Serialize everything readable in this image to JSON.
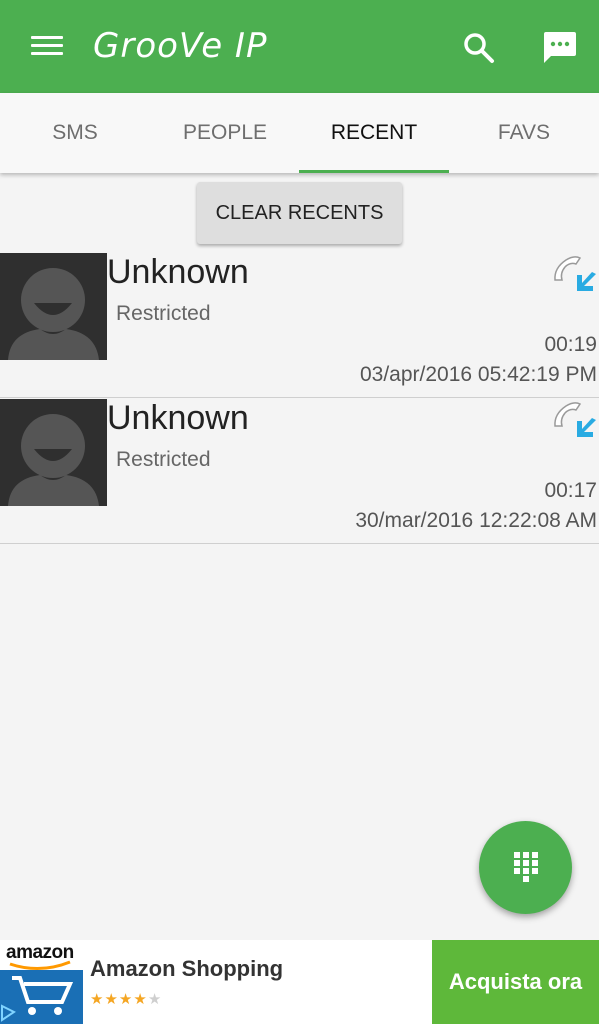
{
  "app": {
    "title": "GrooVe IP",
    "accent_color": "#4caf50"
  },
  "tabs": [
    {
      "label": "SMS",
      "active": false
    },
    {
      "label": "PEOPLE",
      "active": false
    },
    {
      "label": "RECENT",
      "active": true
    },
    {
      "label": "FAVS",
      "active": false
    }
  ],
  "recent": {
    "clear_label": "CLEAR RECENTS",
    "calls": [
      {
        "name": "Unknown",
        "number": "Restricted",
        "duration": "00:19",
        "timestamp": "03/apr/2016 05:42:19 PM",
        "direction_icon": "incoming-call-icon"
      },
      {
        "name": "Unknown",
        "number": "Restricted",
        "duration": "00:17",
        "timestamp": "30/mar/2016 12:22:08 AM",
        "direction_icon": "incoming-call-icon"
      }
    ]
  },
  "icons": {
    "menu": "menu-icon",
    "search": "search-icon",
    "chat": "chat-icon",
    "dialpad": "dialpad-icon"
  },
  "ad": {
    "logo_text": "amazon",
    "title": "Amazon Shopping",
    "rating": 4,
    "rating_max": 5,
    "cta": "Acquista ora",
    "cta_color": "#5eb83a"
  }
}
